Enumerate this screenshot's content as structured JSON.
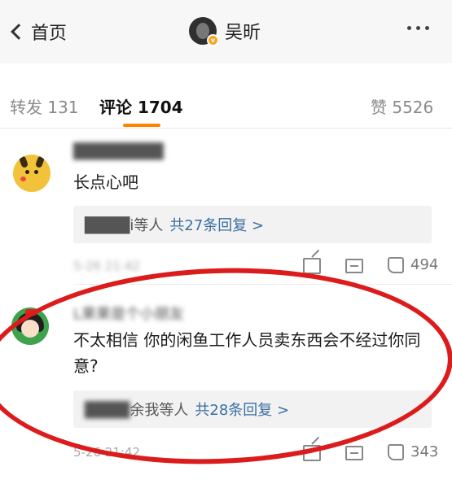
{
  "nav": {
    "back_label": "首页",
    "user_name": "吴昕",
    "avatar_badge": "v",
    "more_icon": "more-dots-icon"
  },
  "tabs": {
    "repost": "转发 131",
    "comments": "评论 1704",
    "likes": "赞 5526",
    "accent_color": "#ff8200"
  },
  "comments": [
    {
      "username": "████████",
      "text": "长点心吧",
      "reply_who": "████i等人",
      "reply_count": "共27条回复 >",
      "time": "5-26 21:42",
      "like_count": "494"
    },
    {
      "username": "L果果是个小朋友",
      "text": "不太相信 你的闲鱼工作人员卖东西会不经过你同意?",
      "reply_who_blur": "████",
      "reply_who": "余我等人",
      "reply_count": "共28条回复 >",
      "time": "5-26 21:42",
      "like_count": "343"
    }
  ],
  "marker_color": "#dc1c1c"
}
